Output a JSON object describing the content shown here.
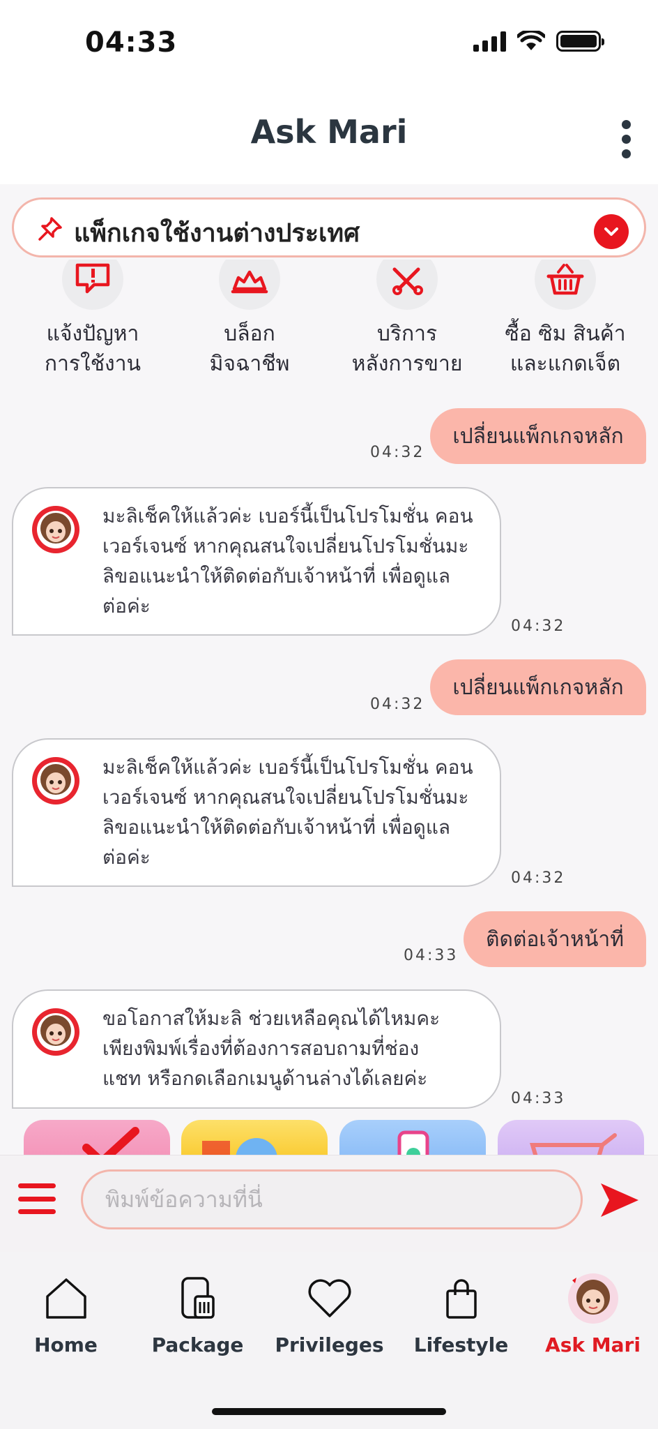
{
  "status_bar": {
    "time": "04:33"
  },
  "header": {
    "title": "Ask Mari"
  },
  "pinned": {
    "title": "แพ็กเกจใช้งานต่างประเทศ"
  },
  "quick_menu": [
    {
      "line1": "แจ้งปัญหา",
      "line2": "การใช้งาน",
      "icon": "alert-message-icon"
    },
    {
      "line1": "บล็อก",
      "line2": "มิจฉาชีพ",
      "icon": "scam-block-icon"
    },
    {
      "line1": "บริการ",
      "line2": "หลังการขาย",
      "icon": "tools-icon"
    },
    {
      "line1": "ซื้อ ซิม สินค้า",
      "line2": "และแกดเจ็ต",
      "icon": "basket-icon"
    }
  ],
  "messages": [
    {
      "from": "user",
      "text": "เปลี่ยนแพ็กเกจหลัก",
      "time": "04:32"
    },
    {
      "from": "bot",
      "lines": [
        "มะลิเช็คให้แล้วค่ะ เบอร์นี้เป็นโปรโมชั่น คอน",
        "เวอร์เจนซ์ หากคุณสนใจเปลี่ยนโปรโมชั่นมะ",
        "ลิขอแนะนำให้ติดต่อกับเจ้าหน้าที่ เพื่อดูแล",
        "ต่อค่ะ"
      ],
      "time": "04:32"
    },
    {
      "from": "user",
      "text": "เปลี่ยนแพ็กเกจหลัก",
      "time": "04:32"
    },
    {
      "from": "bot",
      "lines": [
        "มะลิเช็คให้แล้วค่ะ เบอร์นี้เป็นโปรโมชั่น คอน",
        "เวอร์เจนซ์ หากคุณสนใจเปลี่ยนโปรโมชั่นมะ",
        "ลิขอแนะนำให้ติดต่อกับเจ้าหน้าที่ เพื่อดูแล",
        "ต่อค่ะ"
      ],
      "time": "04:32"
    },
    {
      "from": "user",
      "text": "ติดต่อเจ้าหน้าที่",
      "time": "04:33"
    },
    {
      "from": "bot",
      "lines": [
        "ขอโอกาสให้มะลิ ช่วยเหลือคุณได้ไหมคะ",
        "เพียงพิมพ์เรื่องที่ต้องการสอบถามที่ช่อง",
        "แชท หรือกดเลือกเมนูด้านล่างได้เลยค่ะ"
      ],
      "time": "04:33"
    }
  ],
  "composer": {
    "placeholder": "พิมพ์ข้อความที่นี่"
  },
  "tabs": [
    {
      "label": "Home",
      "icon": "home-icon"
    },
    {
      "label": "Package",
      "icon": "package-sim-icon"
    },
    {
      "label": "Privileges",
      "icon": "heart-icon"
    },
    {
      "label": "Lifestyle",
      "icon": "shopping-bag-icon"
    },
    {
      "label": "Ask Mari",
      "icon": "mari-avatar-icon",
      "active": true
    }
  ],
  "colors": {
    "accent": "#e8161f",
    "user_bubble": "#fbb6aa",
    "banner_border": "#f3b5ab"
  }
}
